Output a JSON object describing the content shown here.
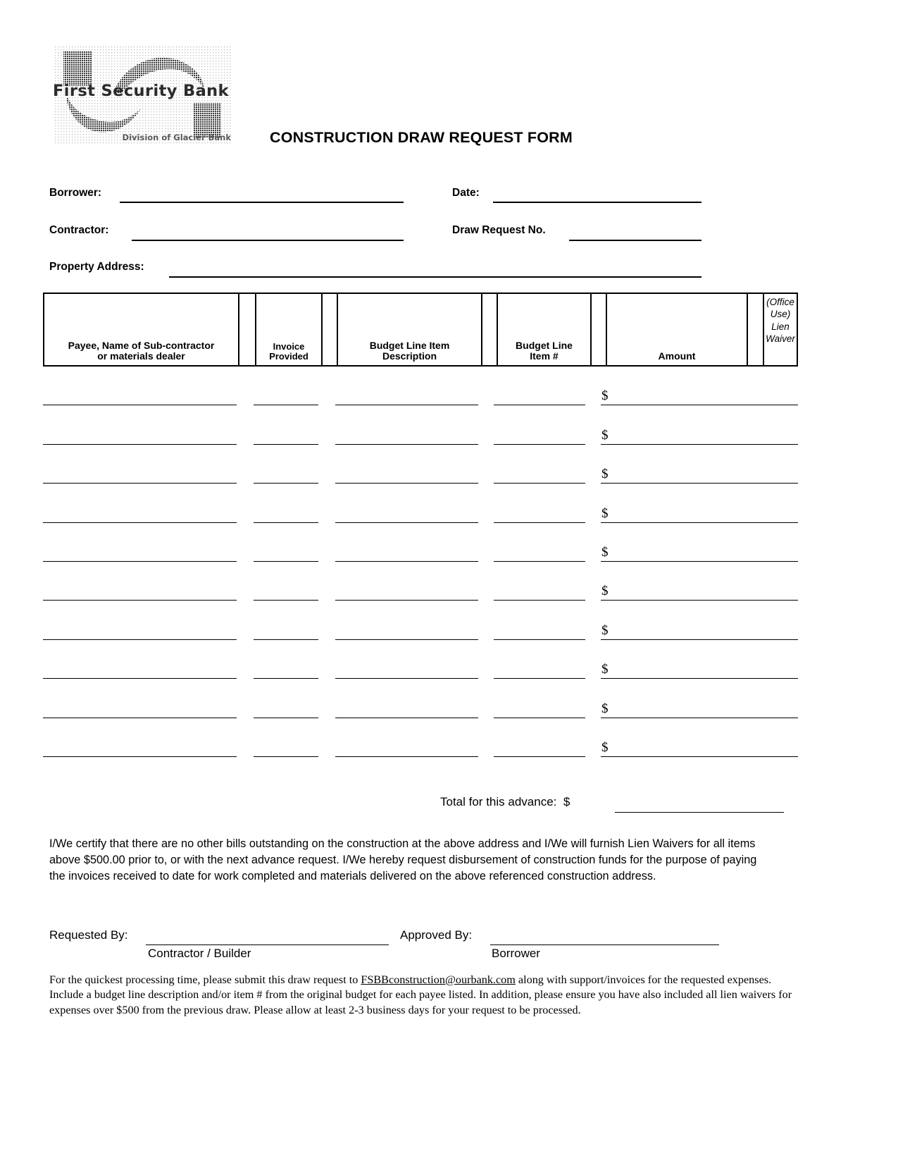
{
  "logo": {
    "wordmark": "First Security Bank",
    "tagline": "Division of Glacier Bank",
    "icon_name": "first-security-bank-logo"
  },
  "title": "CONSTRUCTION DRAW REQUEST FORM",
  "header_fields": {
    "borrower_label": "Borrower:",
    "borrower_value": "",
    "date_label": "Date:",
    "date_value": "",
    "contractor_label": "Contractor:",
    "contractor_value": "",
    "draw_request_no_label": "Draw Request No.",
    "draw_request_no_value": "",
    "property_address_label": "Property Address:",
    "property_address_value": ""
  },
  "table": {
    "columns": [
      {
        "header": "Payee, Name of Sub-contractor\nor materials dealer",
        "line1": "Payee, Name of Sub-contractor",
        "line2": "or materials dealer"
      },
      {
        "header": "",
        "line1": "",
        "line2": ""
      },
      {
        "header": "Invoice\nProvided",
        "line1": "Invoice",
        "line2": "Provided"
      },
      {
        "header": "",
        "line1": "",
        "line2": ""
      },
      {
        "header": "Budget Line Item\nDescription",
        "line1": "Budget Line Item",
        "line2": "Description"
      },
      {
        "header": "",
        "line1": "",
        "line2": ""
      },
      {
        "header": "Budget Line\nItem #",
        "line1": "Budget Line",
        "line2": "Item #"
      },
      {
        "header": "",
        "line1": "",
        "line2": ""
      },
      {
        "header": "Amount",
        "line1": "",
        "line2": "Amount"
      },
      {
        "header": "",
        "line1": "",
        "line2": ""
      },
      {
        "header": "(Office Use) Lien Waiver",
        "line1": "(Office",
        "line2": "Use)",
        "line3": "Lien",
        "line4": "Waiver"
      }
    ],
    "currency_symbol": "$",
    "row_count": 10,
    "rows": [
      {
        "payee": "",
        "invoice_provided": "",
        "budget_line_item_description": "",
        "budget_line_item_number": "",
        "amount": "",
        "lien_waiver": ""
      },
      {
        "payee": "",
        "invoice_provided": "",
        "budget_line_item_description": "",
        "budget_line_item_number": "",
        "amount": "",
        "lien_waiver": ""
      },
      {
        "payee": "",
        "invoice_provided": "",
        "budget_line_item_description": "",
        "budget_line_item_number": "",
        "amount": "",
        "lien_waiver": ""
      },
      {
        "payee": "",
        "invoice_provided": "",
        "budget_line_item_description": "",
        "budget_line_item_number": "",
        "amount": "",
        "lien_waiver": ""
      },
      {
        "payee": "",
        "invoice_provided": "",
        "budget_line_item_description": "",
        "budget_line_item_number": "",
        "amount": "",
        "lien_waiver": ""
      },
      {
        "payee": "",
        "invoice_provided": "",
        "budget_line_item_description": "",
        "budget_line_item_number": "",
        "amount": "",
        "lien_waiver": ""
      },
      {
        "payee": "",
        "invoice_provided": "",
        "budget_line_item_description": "",
        "budget_line_item_number": "",
        "amount": "",
        "lien_waiver": ""
      },
      {
        "payee": "",
        "invoice_provided": "",
        "budget_line_item_description": "",
        "budget_line_item_number": "",
        "amount": "",
        "lien_waiver": ""
      },
      {
        "payee": "",
        "invoice_provided": "",
        "budget_line_item_description": "",
        "budget_line_item_number": "",
        "amount": "",
        "lien_waiver": ""
      },
      {
        "payee": "",
        "invoice_provided": "",
        "budget_line_item_description": "",
        "budget_line_item_number": "",
        "amount": "",
        "lien_waiver": ""
      }
    ]
  },
  "total": {
    "label": "Total for this advance:",
    "currency_symbol": "$",
    "value": ""
  },
  "certification": "I/We certify that there are no other bills outstanding on the construction at the above address and I/We will furnish Lien Waivers for all items above $500.00 prior to, or with the next advance request. I/We hereby request disbursement of construction funds for the purpose of paying the invoices received to date for work completed and materials delivered on the above referenced construction address.",
  "signatures": {
    "requested_by_label": "Requested By:",
    "requested_by_value": "",
    "requested_by_caption": "Contractor / Builder",
    "approved_by_label": "Approved By:",
    "approved_by_value": "",
    "approved_by_caption": "Borrower"
  },
  "footer": {
    "part1": "For the quickest processing time, please submit this draw request to ",
    "email": "FSBBconstruction@ourbank.com",
    "part2": " along with support/invoices for the requested expenses.  Include a budget line description and/or item # from the original budget for each payee listed. In addition, please ensure you have also included all lien waivers for expenses over $500 from the previous draw.  Please allow at least 2-3 business days for your request to be processed."
  },
  "colors": {
    "page_background": "#ffffff",
    "ink": "#000000",
    "logo_dark": "#2b2b2b",
    "logo_gray": "#5a5a5a"
  }
}
